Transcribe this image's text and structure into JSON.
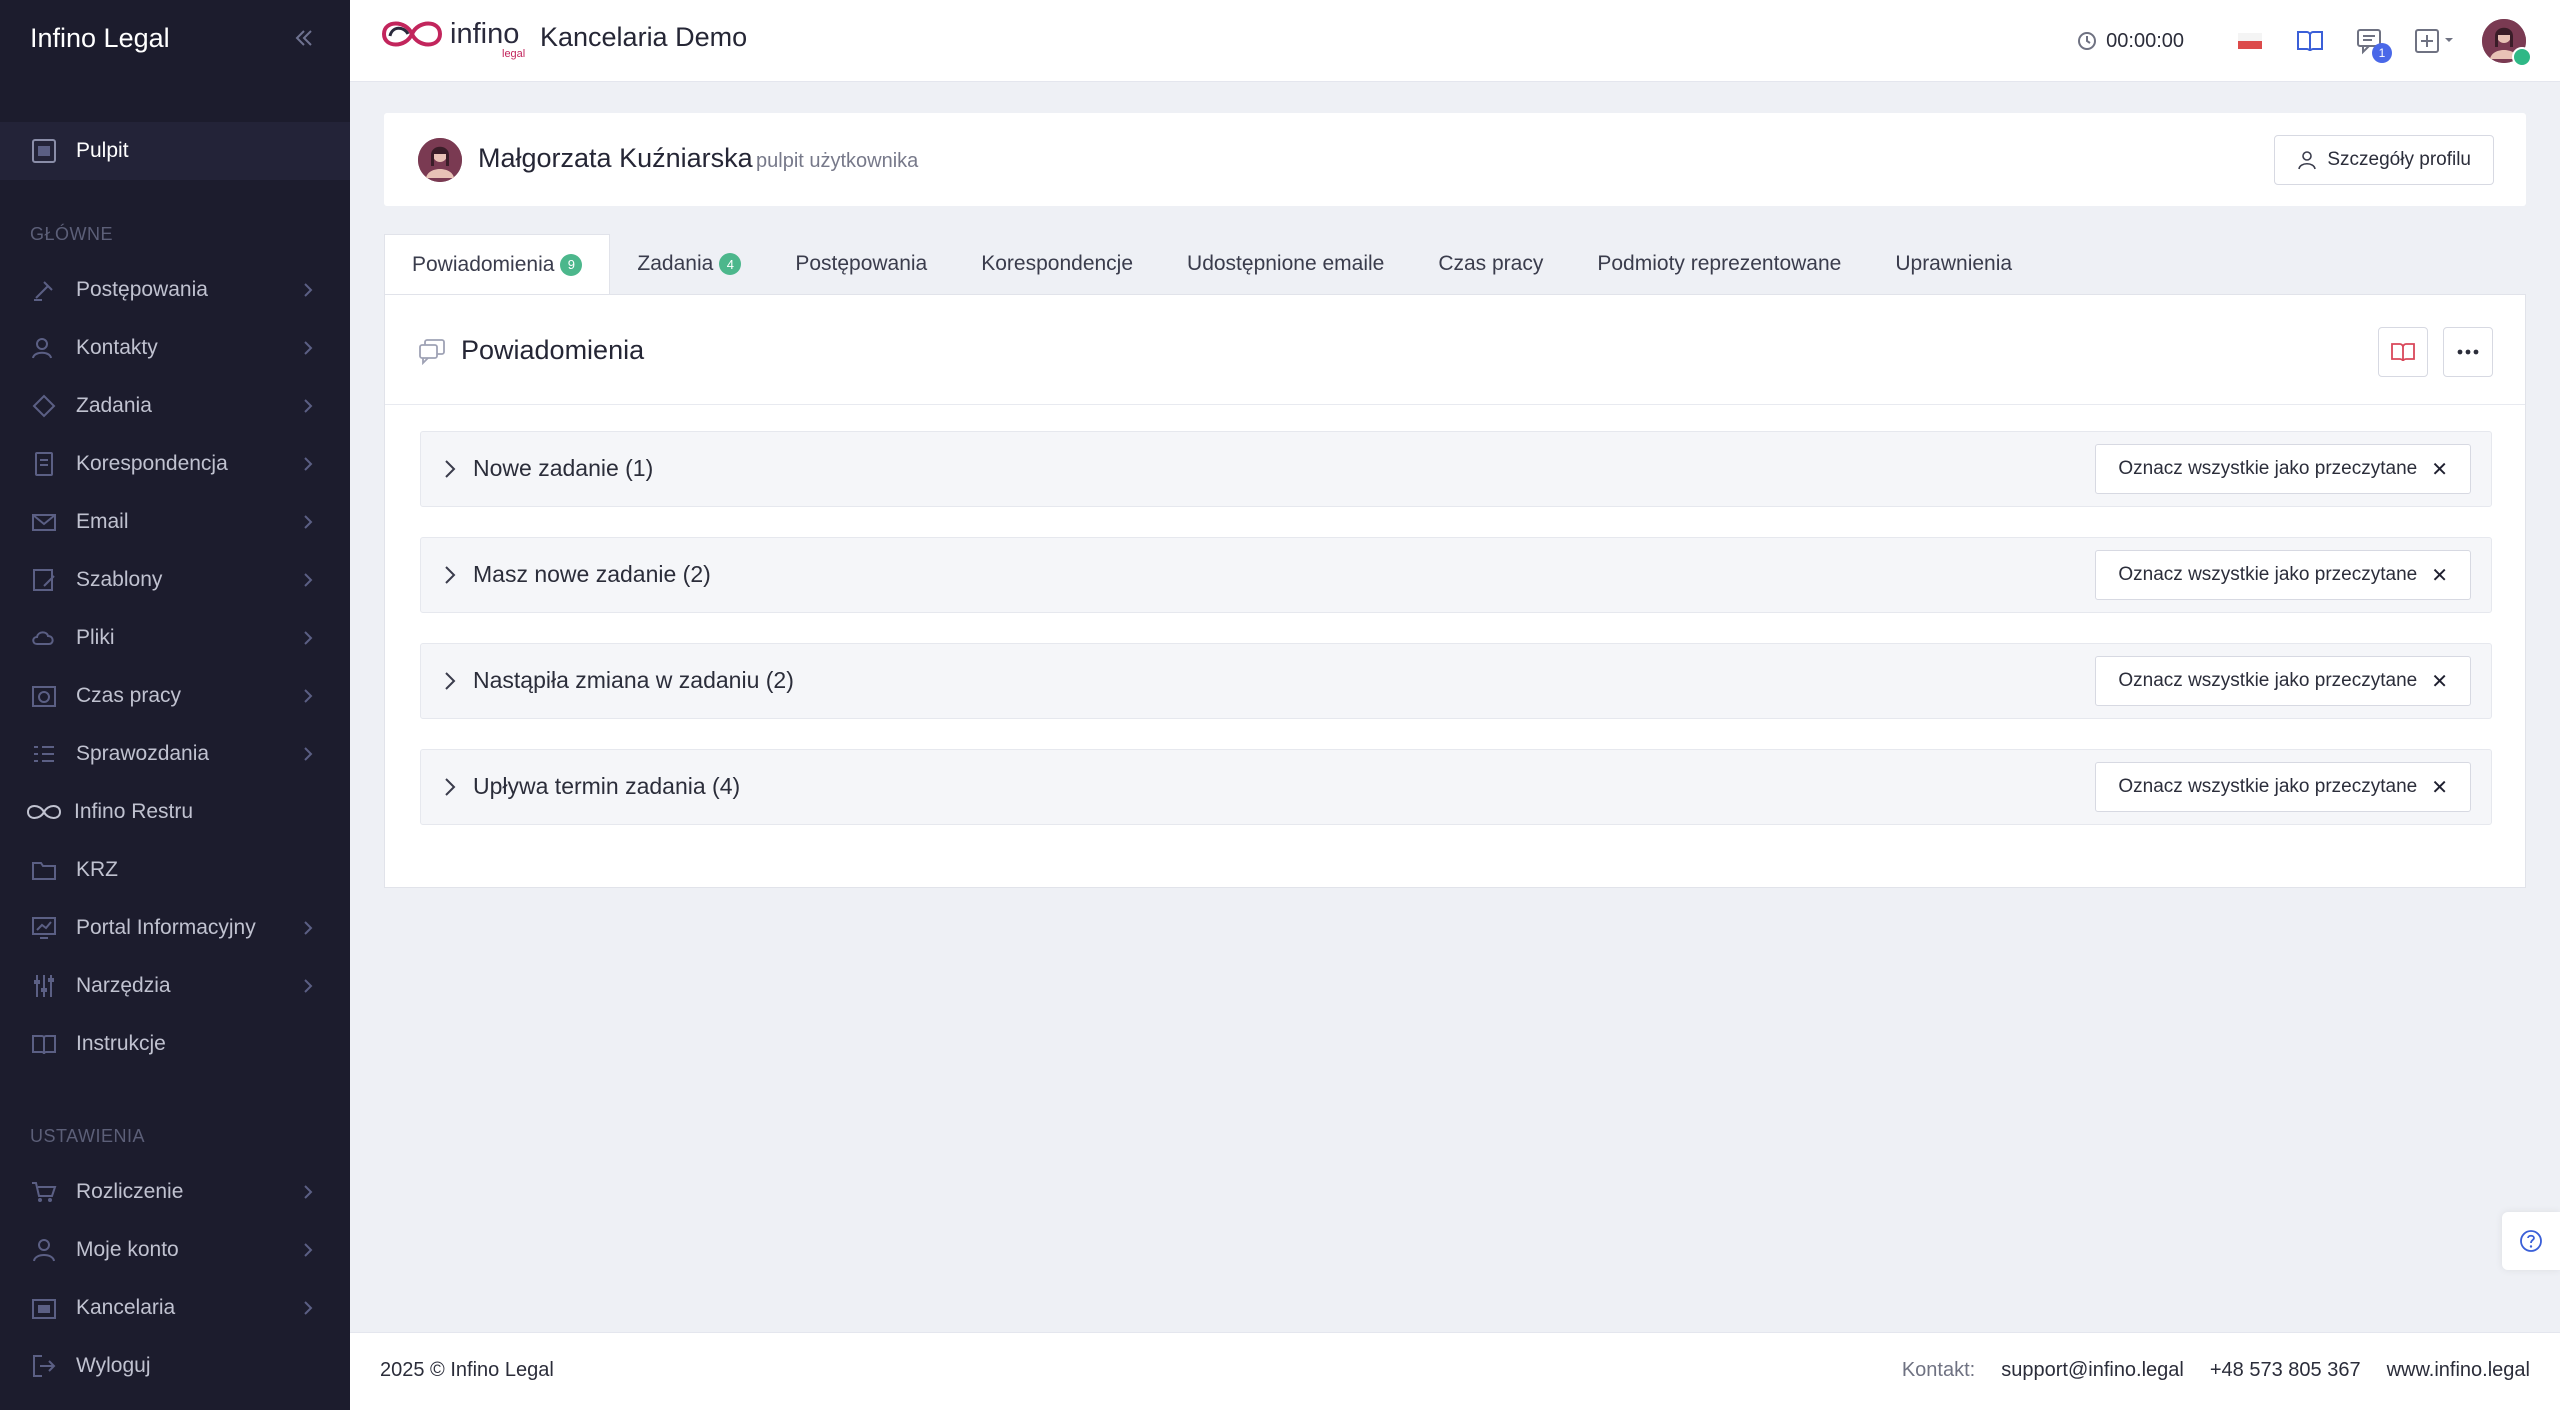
{
  "sidebar": {
    "brand": "Infino Legal",
    "pulpit": "Pulpit",
    "section_main": "GŁÓWNE",
    "items": [
      {
        "label": "Postępowania"
      },
      {
        "label": "Kontakty"
      },
      {
        "label": "Zadania"
      },
      {
        "label": "Korespondencja"
      },
      {
        "label": "Email"
      },
      {
        "label": "Szablony"
      },
      {
        "label": "Pliki"
      },
      {
        "label": "Czas pracy"
      },
      {
        "label": "Sprawozdania"
      },
      {
        "label": "Infino Restru"
      },
      {
        "label": "KRZ"
      },
      {
        "label": "Portal Informacyjny"
      },
      {
        "label": "Narzędzia"
      },
      {
        "label": "Instrukcje"
      }
    ],
    "section_settings": "USTAWIENIA",
    "settings_items": [
      {
        "label": "Rozliczenie"
      },
      {
        "label": "Moje konto"
      },
      {
        "label": "Kancelaria"
      },
      {
        "label": "Wyloguj"
      }
    ]
  },
  "topbar": {
    "logo_text": "infino",
    "logo_sub": "legal",
    "org_name": "Kancelaria Demo",
    "timer": "00:00:00",
    "messages_count": "1"
  },
  "user": {
    "name": "Małgorzata Kuźniarska",
    "subtitle": "pulpit użytkownika",
    "profile_button": "Szczegóły profilu"
  },
  "tabs": [
    {
      "label": "Powiadomienia",
      "count": "9"
    },
    {
      "label": "Zadania",
      "count": "4"
    },
    {
      "label": "Postępowania"
    },
    {
      "label": "Korespondencje"
    },
    {
      "label": "Udostępnione emaile"
    },
    {
      "label": "Czas pracy"
    },
    {
      "label": "Podmioty reprezentowane"
    },
    {
      "label": "Uprawnienia"
    }
  ],
  "notifications": {
    "title": "Powiadomienia",
    "groups": [
      {
        "title": "Nowe zadanie (1)",
        "action": "Oznacz wszystkie jako przeczytane"
      },
      {
        "title": "Masz nowe zadanie (2)",
        "action": "Oznacz wszystkie jako przeczytane"
      },
      {
        "title": "Nastąpiła zmiana w zadaniu (2)",
        "action": "Oznacz wszystkie jako przeczytane"
      },
      {
        "title": "Upływa termin zadania (4)",
        "action": "Oznacz wszystkie jako przeczytane"
      }
    ]
  },
  "footer": {
    "copyright": "2025 © Infino Legal",
    "contact_label": "Kontakt:",
    "email": "support@infino.legal",
    "phone": "+48 573 805 367",
    "website": "www.infino.legal"
  },
  "colors": {
    "sidebar_bg": "#1c1c2d",
    "accent_green": "#4cb78c",
    "accent_blue": "#4a68e8",
    "brand_red": "#c2255c"
  }
}
